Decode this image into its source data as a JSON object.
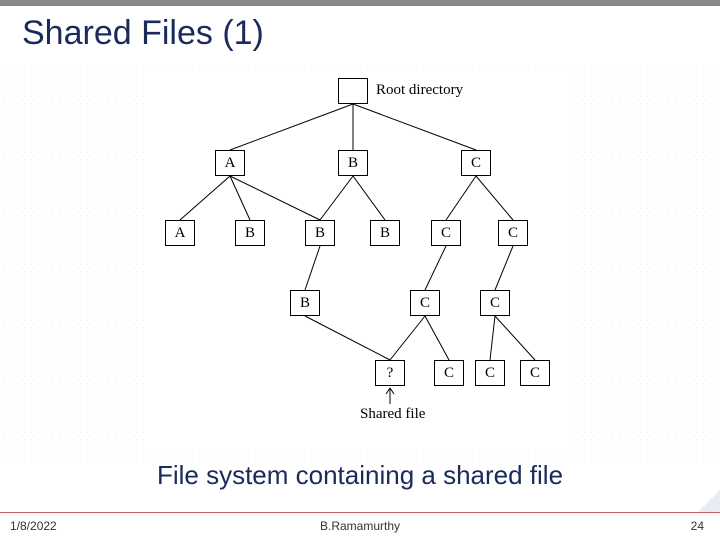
{
  "title": "Shared Files (1)",
  "caption": "File system containing a shared file",
  "labels": {
    "root": "Root directory",
    "shared": "Shared file"
  },
  "nodes": {
    "root": "",
    "A": "A",
    "B": "B",
    "C": "C",
    "A1": "A",
    "B1a": "B",
    "B1b": "B",
    "B1c": "B",
    "C1a": "C",
    "C1b": "C",
    "B2": "B",
    "C2a": "C",
    "C2b": "C",
    "q": "?",
    "C3a": "C",
    "C3b": "C",
    "C3c": "C"
  },
  "footer": {
    "date": "1/8/2022",
    "author": "B.Ramamurthy",
    "page": "24"
  }
}
